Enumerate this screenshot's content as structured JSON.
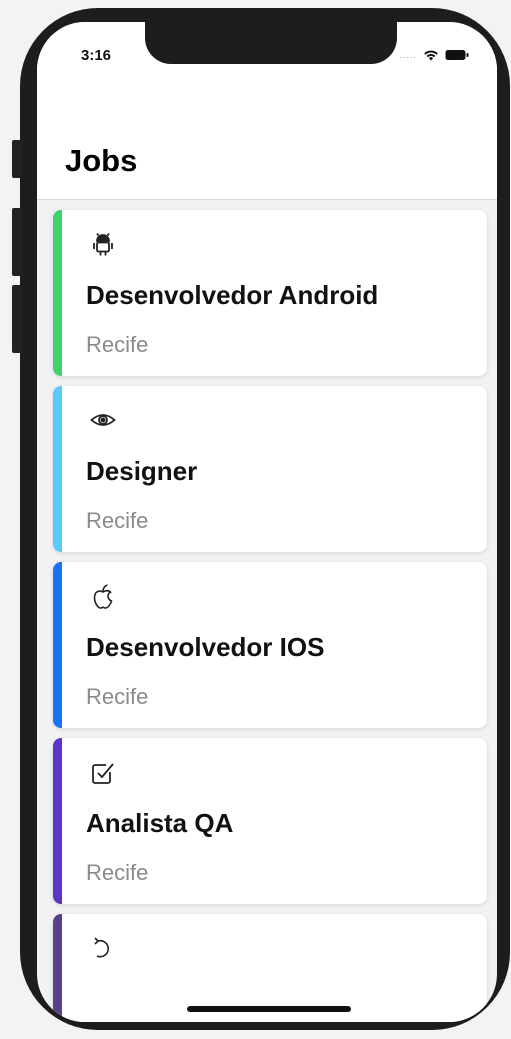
{
  "status_bar": {
    "time": "3:16",
    "dots": "....."
  },
  "header": {
    "title": "Jobs"
  },
  "jobs": [
    {
      "icon": "android-icon",
      "title": "Desenvolvedor Android",
      "city": "Recife",
      "accent": "#3ed36a"
    },
    {
      "icon": "eye-icon",
      "title": "Designer",
      "city": "Recife",
      "accent": "#5ac8fa"
    },
    {
      "icon": "apple-icon",
      "title": "Desenvolvedor IOS",
      "city": "Recife",
      "accent": "#1a73f5"
    },
    {
      "icon": "checkbox-icon",
      "title": "Analista QA",
      "city": "Recife",
      "accent": "#5b35c7"
    },
    {
      "icon": "refresh-icon",
      "title": "",
      "city": "",
      "accent": "#58418a"
    }
  ]
}
